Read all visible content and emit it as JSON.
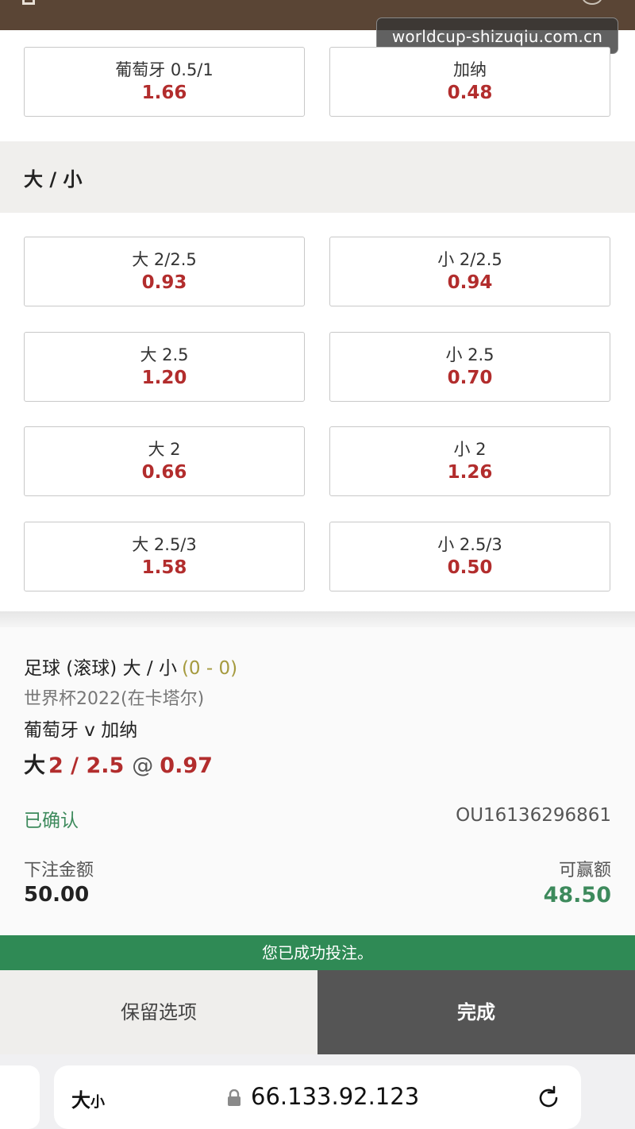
{
  "watermark": "worldcup-shizuqiu.com.cn",
  "handicap_row": [
    {
      "label": "葡萄牙 0.5/1",
      "odds": "1.66"
    },
    {
      "label": "加纳",
      "odds": "0.48"
    }
  ],
  "over_under": {
    "title": "大 / 小",
    "options": [
      {
        "label": "大 2/2.5",
        "odds": "0.93"
      },
      {
        "label": "小 2/2.5",
        "odds": "0.94"
      },
      {
        "label": "大 2.5",
        "odds": "1.20"
      },
      {
        "label": "小 2.5",
        "odds": "0.70"
      },
      {
        "label": "大 2",
        "odds": "0.66"
      },
      {
        "label": "小 2",
        "odds": "1.26"
      },
      {
        "label": "大 2.5/3",
        "odds": "1.58"
      },
      {
        "label": "小 2.5/3",
        "odds": "0.50"
      }
    ]
  },
  "bet_slip": {
    "market": "足球 (滚球) 大 / 小",
    "score": "(0 - 0)",
    "league": "世界杯2022(在卡塔尔)",
    "teams": "葡萄牙 v 加纳",
    "selection_name": "大",
    "selection_line": "2 / 2.5",
    "at_symbol": "@",
    "selection_price": "0.97",
    "status": "已确认",
    "reference": "OU16136296861",
    "stake_label": "下注金额",
    "stake_value": "50.00",
    "win_label": "可赢额",
    "win_value": "48.50"
  },
  "success_message": "您已成功投注。",
  "buttons": {
    "keep": "保留选项",
    "done": "完成"
  },
  "browser": {
    "text_size_big": "大",
    "text_size_small": "小",
    "url": "66.133.92.123"
  },
  "colors": {
    "odds_red": "#b22d2d",
    "success_green": "#2f8a55",
    "win_green": "#3d8a5c",
    "done_button": "#555555"
  }
}
